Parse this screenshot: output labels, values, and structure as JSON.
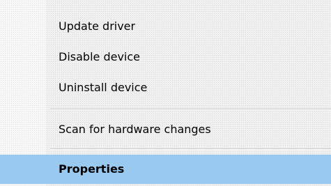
{
  "context_menu": {
    "items": [
      {
        "label": "Update driver"
      },
      {
        "label": "Disable device"
      },
      {
        "label": "Uninstall device"
      },
      {
        "label": "Scan for hardware changes"
      },
      {
        "label": "Properties",
        "highlighted": true,
        "bold": true
      }
    ],
    "colors": {
      "highlight": "#99c9ef",
      "background": "#f0f0f0",
      "separator": "#c8c8c8"
    }
  }
}
